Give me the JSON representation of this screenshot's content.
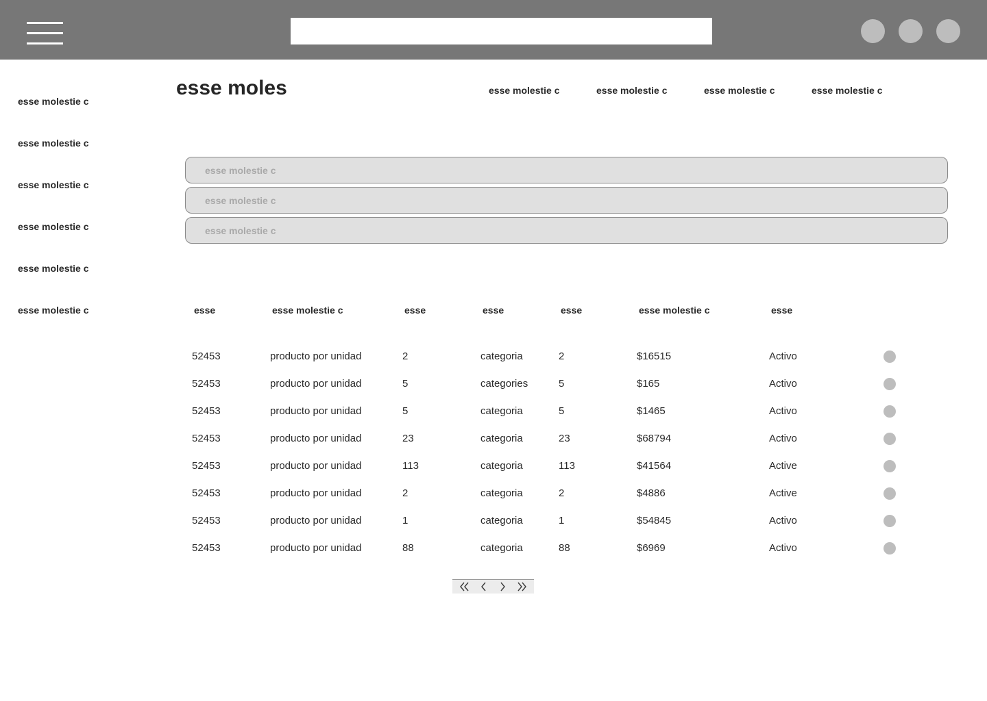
{
  "topbar": {
    "menu_icon": "hamburger-menu-icon",
    "search_value": "",
    "search_placeholder": "",
    "circle_buttons": [
      "circle-button",
      "circle-button",
      "circle-button"
    ]
  },
  "sidebar": {
    "items": [
      {
        "label": "esse molestie c"
      },
      {
        "label": "esse molestie c"
      },
      {
        "label": "esse molestie c"
      },
      {
        "label": "esse molestie c"
      },
      {
        "label": "esse molestie c"
      },
      {
        "label": "esse molestie c"
      }
    ]
  },
  "header": {
    "title": "esse moles",
    "nav": [
      {
        "label": "esse molestie c"
      },
      {
        "label": "esse molestie c"
      },
      {
        "label": "esse molestie c"
      },
      {
        "label": "esse molestie c"
      }
    ]
  },
  "filters": [
    {
      "placeholder": "esse molestie c",
      "value": ""
    },
    {
      "placeholder": "esse molestie c",
      "value": ""
    },
    {
      "placeholder": "esse molestie c",
      "value": ""
    }
  ],
  "table": {
    "headers": [
      "esse",
      "esse molestie c",
      "esse",
      "esse",
      "esse",
      "esse molestie c",
      "esse"
    ],
    "rows": [
      [
        "52453",
        "producto por unidad",
        "2",
        "categoria",
        "2",
        "$16515",
        "Activo"
      ],
      [
        "52453",
        "producto por unidad",
        "5",
        "categories",
        "5",
        "$165",
        "Activo"
      ],
      [
        "52453",
        "producto por unidad",
        "5",
        "categoria",
        "5",
        "$1465",
        "Activo"
      ],
      [
        "52453",
        "producto por unidad",
        "23",
        "categoria",
        "23",
        "$68794",
        "Activo"
      ],
      [
        "52453",
        "producto por unidad",
        "113",
        "categoria",
        "113",
        "$41564",
        "Active"
      ],
      [
        "52453",
        "producto por unidad",
        "2",
        "categoria",
        "2",
        "$4886",
        "Active"
      ],
      [
        "52453",
        "producto por unidad",
        "1",
        "categoria",
        "1",
        "$54845",
        "Activo"
      ],
      [
        "52453",
        "producto por unidad",
        "88",
        "categoria",
        "88",
        "$6969",
        "Activo"
      ]
    ]
  },
  "pagination": {
    "buttons": [
      "first-page-icon",
      "previous-page-icon",
      "next-page-icon",
      "last-page-icon"
    ]
  },
  "colors": {
    "topbar_bg": "#777777",
    "circle": "#bdbdbd",
    "field_bg": "#e0e0e0",
    "text": "#2a2a2a",
    "placeholder": "#a9a9a9"
  }
}
